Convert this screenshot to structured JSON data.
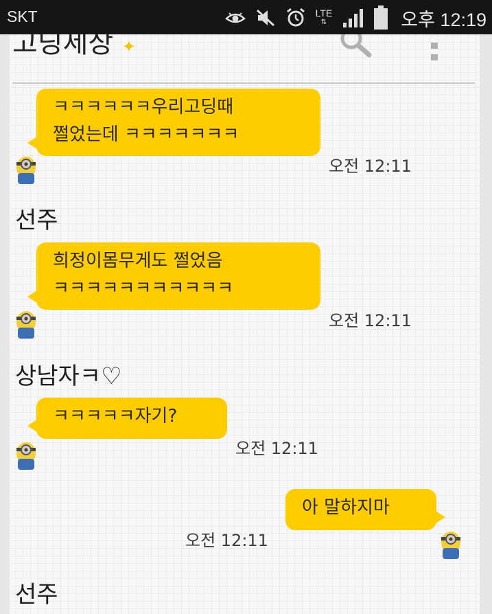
{
  "status_bar": {
    "carrier": "SKT",
    "network": "LTE",
    "clock": "오후 12:19"
  },
  "header": {
    "title": "고딩세상",
    "title_emoji": "✦"
  },
  "messages": [
    {
      "type": "incoming",
      "lines": [
        "ㅋㅋㅋㅋㅋㅋ우리고딩때",
        "쩔었는데 ㅋㅋㅋㅋㅋㅋㅋ"
      ],
      "time": "오전 12:11"
    },
    {
      "type": "sender",
      "name": "선주"
    },
    {
      "type": "incoming",
      "lines": [
        "희정이몸무게도 쩔었음",
        "ㅋㅋㅋㅋㅋㅋㅋㅋㅋㅋㅋ"
      ],
      "time": "오전 12:11"
    },
    {
      "type": "sender",
      "name": "상남자ㅋ♡"
    },
    {
      "type": "incoming",
      "lines": [
        "ㅋㅋㅋㅋㅋ자기?"
      ],
      "time": "오전 12:11"
    },
    {
      "type": "outgoing",
      "lines": [
        "아 말하지마"
      ],
      "time": "오전 12:11"
    },
    {
      "type": "sender",
      "name": "선주"
    }
  ],
  "colors": {
    "bubble": "#ffcc00",
    "background": "#f7f7f8",
    "status_bar": "#151515"
  },
  "icons": [
    "eye-icon",
    "mute-icon",
    "alarm-icon",
    "signal-icon",
    "battery-icon",
    "search-icon",
    "more-menu-icon",
    "minion-avatar-icon"
  ]
}
